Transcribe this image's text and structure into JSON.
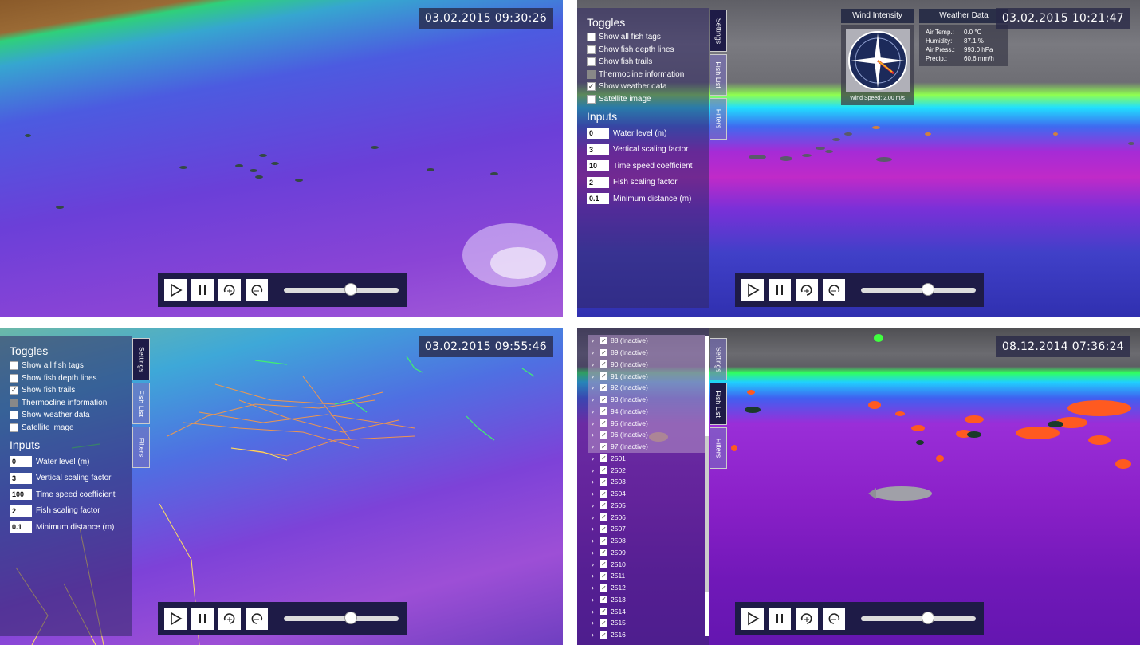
{
  "panels": [
    {
      "timestamp": "03.02.2015 09:30:26"
    },
    {
      "timestamp": "03.02.2015 10:21:47"
    },
    {
      "timestamp": "03.02.2015 09:55:46"
    },
    {
      "timestamp": "08.12.2014 07:36:24"
    }
  ],
  "tabs": {
    "settings": "Settings",
    "fish_list": "Fish List",
    "filters": "Filters"
  },
  "toggles": {
    "title": "Toggles",
    "items": [
      "Show all fish tags",
      "Show fish depth lines",
      "Show fish trails",
      "Thermocline information",
      "Show weather data",
      "Satellite image"
    ]
  },
  "inputs": {
    "title": "Inputs",
    "labels": [
      "Water level (m)",
      "Vertical scaling factor",
      "Time speed coefficient",
      "Fish scaling factor",
      "Minimum distance (m)"
    ],
    "values_panel2": [
      "0",
      "3",
      "10",
      "2",
      "0.1"
    ],
    "values_panel3": [
      "0",
      "3",
      "100",
      "2",
      "0.1"
    ]
  },
  "weather": {
    "wind_title": "Wind Intensity",
    "data_title": "Weather Data",
    "wind_speed": "Wind Speed: 2.00 m/s",
    "rows": [
      {
        "label": "Air Temp.:",
        "value": "0.0 °C"
      },
      {
        "label": "Humidity:",
        "value": "87.1 %"
      },
      {
        "label": "Air Press.:",
        "value": "993.0 hPa"
      },
      {
        "label": "Precip.:",
        "value": "60.6 mm/h"
      }
    ]
  },
  "fish_list": [
    "88 (Inactive)",
    "89 (Inactive)",
    "90 (Inactive)",
    "91 (Inactive)",
    "92 (Inactive)",
    "93 (Inactive)",
    "94 (Inactive)",
    "95 (Inactive)",
    "96 (Inactive)",
    "97 (Inactive)",
    "2501",
    "2502",
    "2503",
    "2504",
    "2505",
    "2506",
    "2507",
    "2508",
    "2509",
    "2510",
    "2511",
    "2512",
    "2513",
    "2514",
    "2515",
    "2516"
  ],
  "playback": {
    "slider_fraction": 0.58
  },
  "colors": {
    "toolbar": "#1e1b47",
    "timestamp_bg": "#28284a"
  }
}
